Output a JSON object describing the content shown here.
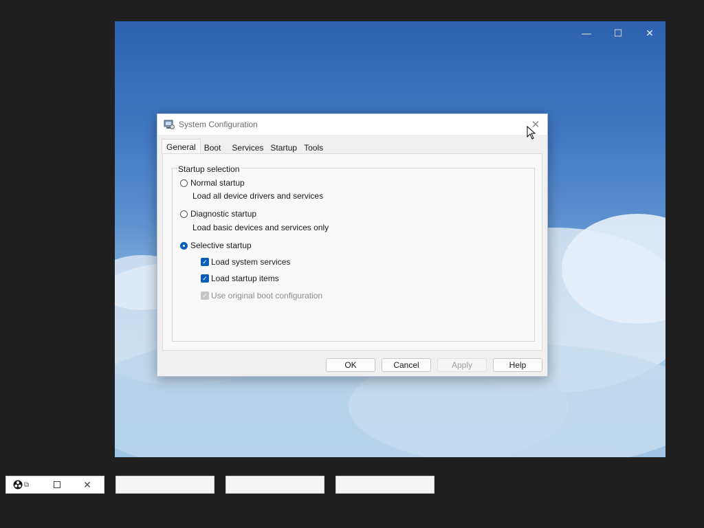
{
  "outer_window": {
    "controls": [
      "—",
      "☐",
      "✕"
    ]
  },
  "dialog": {
    "title": "System Configuration",
    "close_glyph": "✕",
    "tabs": [
      {
        "label": "General",
        "active": true
      },
      {
        "label": "Boot",
        "active": false
      },
      {
        "label": "Services",
        "active": false
      },
      {
        "label": "Startup",
        "active": false
      },
      {
        "label": "Tools",
        "active": false
      }
    ],
    "group_title": "Startup selection",
    "options": {
      "normal": {
        "label": "Normal startup",
        "description": "Load all device drivers and services",
        "selected": false
      },
      "diagnostic": {
        "label": "Diagnostic startup",
        "description": "Load basic devices and services only",
        "selected": false
      },
      "selective": {
        "label": "Selective startup",
        "selected": true
      }
    },
    "checkboxes": {
      "system_services": {
        "label": "Load system services",
        "checked": true,
        "disabled": false
      },
      "startup_items": {
        "label": "Load startup items",
        "checked": true,
        "disabled": false
      },
      "original_boot": {
        "label": "Use original boot configuration",
        "checked": true,
        "disabled": true
      }
    },
    "buttons": {
      "ok": "OK",
      "cancel": "Cancel",
      "apply": "Apply",
      "help": "Help"
    }
  },
  "taskbar": {
    "thumbnail_count": 4
  },
  "colors": {
    "accent": "#0a5fb5",
    "desktop_bg": "#1f1f1f",
    "sky_top": "#2d62b0",
    "sky_bottom": "#a9cbe7"
  }
}
